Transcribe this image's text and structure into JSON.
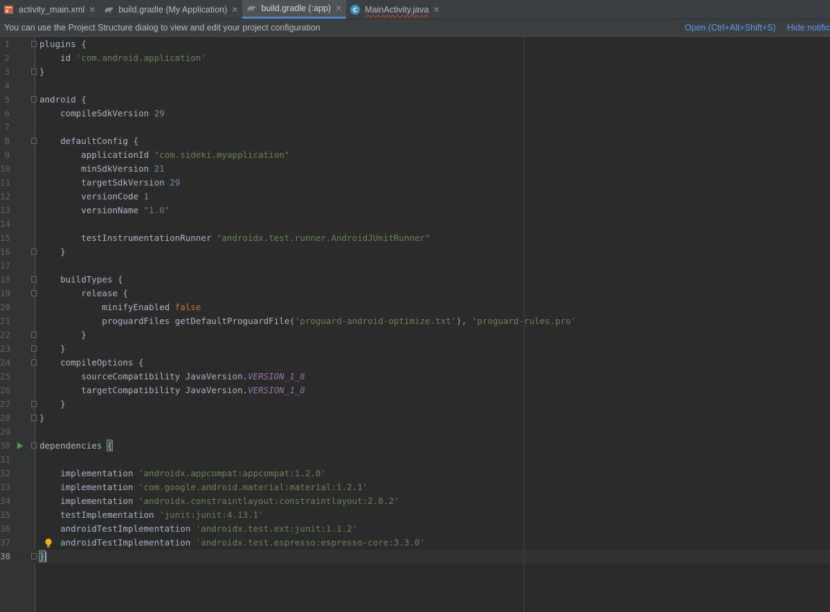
{
  "tabs": [
    {
      "label": "activity_main.xml",
      "icon": "xml-layout-icon",
      "active": false,
      "error": false
    },
    {
      "label": "build.gradle (My Application)",
      "icon": "gradle-icon",
      "active": false,
      "error": false
    },
    {
      "label": "build.gradle (:app)",
      "icon": "gradle-icon",
      "active": true,
      "error": false
    },
    {
      "label": "MainActivity.java",
      "icon": "java-class-icon",
      "active": false,
      "error": true
    }
  ],
  "notification": {
    "text": "You can use the Project Structure dialog to view and edit your project configuration",
    "open_link": "Open (Ctrl+Alt+Shift+S)",
    "hide_link": "Hide notific"
  },
  "editor": {
    "current_line": 38,
    "lines": [
      "plugins {",
      "    id 'com.android.application'",
      "}",
      "",
      "android {",
      "    compileSdkVersion 29",
      "",
      "    defaultConfig {",
      "        applicationId \"com.sideki.myapplication\"",
      "        minSdkVersion 21",
      "        targetSdkVersion 29",
      "        versionCode 1",
      "        versionName \"1.0\"",
      "",
      "        testInstrumentationRunner \"androidx.test.runner.AndroidJUnitRunner\"",
      "    }",
      "",
      "    buildTypes {",
      "        release {",
      "            minifyEnabled false",
      "            proguardFiles getDefaultProguardFile('proguard-android-optimize.txt'), 'proguard-rules.pro'",
      "        }",
      "    }",
      "    compileOptions {",
      "        sourceCompatibility JavaVersion.VERSION_1_8",
      "        targetCompatibility JavaVersion.VERSION_1_8",
      "    }",
      "}",
      "",
      "dependencies {",
      "",
      "    implementation 'androidx.appcompat:appcompat:1.2.0'",
      "    implementation 'com.google.android.material:material:1.2.1'",
      "    implementation 'androidx.constraintlayout:constraintlayout:2.0.2'",
      "    testImplementation 'junit:junit:4.13.1'",
      "    androidTestImplementation 'androidx.test.ext:junit:1.1.2'",
      "    androidTestImplementation 'androidx.test.espresso:espresso-core:3.3.0'",
      "}"
    ],
    "fold_lines": [
      1,
      3,
      5,
      8,
      16,
      18,
      19,
      22,
      23,
      24,
      27,
      28,
      30,
      38
    ],
    "run_gutter_line": 30,
    "bulb_line": 37,
    "colors": {
      "string": "#6a8759",
      "number": "#6897bb",
      "keyword": "#cc7832",
      "constant": "#9876aa",
      "text": "#a9b7c6"
    }
  }
}
